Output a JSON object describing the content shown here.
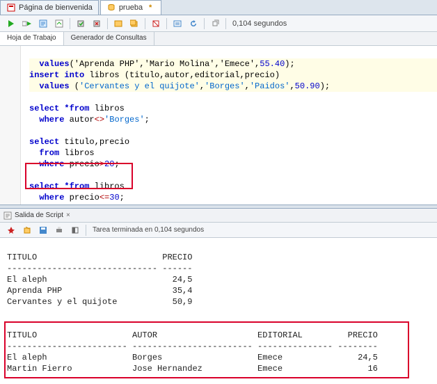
{
  "tabs": [
    {
      "label": "Página de bienvenida",
      "icon": "file-icon"
    },
    {
      "label": "prueba",
      "icon": "sql-icon"
    }
  ],
  "status": {
    "timing": "0,104 segundos"
  },
  "subtabs": {
    "left": "Hoja de Trabajo",
    "right": "Generador de Consultas"
  },
  "code": {
    "l1a": "  values",
    "l1b": "('Aprenda PHP','Mario Molina','Emece',",
    "l1n": "55.40",
    "l1c": ");",
    "l2a": "insert into",
    "l2b": " libros (titulo,autor,editorial,precio)",
    "l3a": "  values",
    "l3b": " (",
    "l3s1": "'Cervantes y el quijote'",
    "l3s2": "'Borges'",
    "l3s3": "'Paidos'",
    "l3n": "50.90",
    "l3c": ");",
    "l5a": "select *from",
    "l5b": " libros",
    "l6a": "  where",
    "l6b": " autor",
    "l6op": "<>",
    "l6s": "'Borges'",
    "l6c": ";",
    "l8a": "select",
    "l8b": " titulo,precio",
    "l9a": "  from",
    "l9b": " libros",
    "l10a": "  where",
    "l10b": " precio",
    "l10op": ">",
    "l10n": "20",
    "l10c": ";",
    "l12a": "select *from",
    "l12b": " libros",
    "l13a": "  where",
    "l13b": " precio",
    "l13op": "<=",
    "l13n": "30",
    "l13c": ";"
  },
  "output_tab": "Salida de Script",
  "output_status": "Tarea terminada en 0,104 segundos",
  "results1": {
    "hdr": "TITULO                         PRECIO",
    "sep": "------------------------------ ------",
    "r1": "El aleph                         24,5",
    "r2": "Aprenda PHP                      35,4",
    "r3": "Cervantes y el quijote           50,9"
  },
  "results2": {
    "hdr": "TITULO                   AUTOR                    EDITORIAL         PRECIO",
    "sep": "------------------------ ------------------------ --------------- --------",
    "r1": "El aleph                 Borges                   Emece               24,5",
    "r2": "Martin Fierro            Jose Hernandez           Emece                 16"
  },
  "chart_data": {
    "type": "table",
    "tables": [
      {
        "columns": [
          "TITULO",
          "PRECIO"
        ],
        "rows": [
          [
            "El aleph",
            24.5
          ],
          [
            "Aprenda PHP",
            35.4
          ],
          [
            "Cervantes y el quijote",
            50.9
          ]
        ]
      },
      {
        "columns": [
          "TITULO",
          "AUTOR",
          "EDITORIAL",
          "PRECIO"
        ],
        "rows": [
          [
            "El aleph",
            "Borges",
            "Emece",
            24.5
          ],
          [
            "Martin Fierro",
            "Jose Hernandez",
            "Emece",
            16
          ]
        ]
      }
    ]
  }
}
